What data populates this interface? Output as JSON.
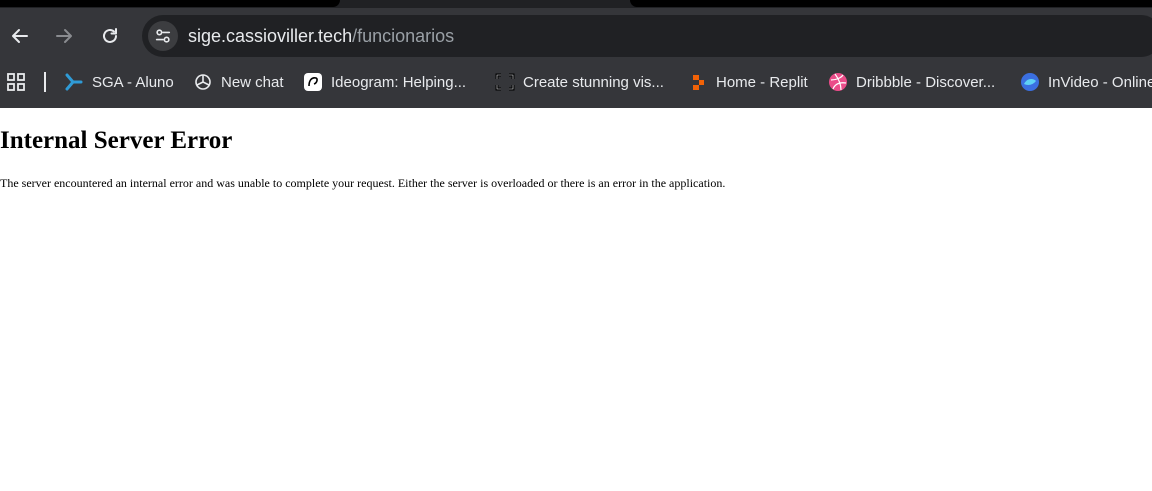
{
  "browser": {
    "url_host": "sige.cassioviller.tech",
    "url_path": "/funcionarios",
    "back_icon": "arrow-left-icon",
    "forward_icon": "arrow-right-icon",
    "reload_icon": "reload-icon",
    "site_info_icon": "tune-icon"
  },
  "bookmarks": {
    "apps_icon": "apps-grid-icon",
    "items": [
      {
        "label": "SGA - Aluno",
        "icon": "sga-icon"
      },
      {
        "label": "New chat",
        "icon": "openai-icon"
      },
      {
        "label": "Ideogram: Helping...",
        "icon": "ideogram-icon"
      },
      {
        "label": "Create stunning vis...",
        "icon": "frame-icon"
      },
      {
        "label": "Home - Replit",
        "icon": "replit-icon"
      },
      {
        "label": "Dribbble - Discover...",
        "icon": "dribbble-icon"
      },
      {
        "label": "InVideo - Online",
        "icon": "invideo-icon"
      }
    ]
  },
  "page": {
    "title": "Internal Server Error",
    "message": "The server encountered an internal error and was unable to complete your request. Either the server is overloaded or there is an error in the application."
  }
}
